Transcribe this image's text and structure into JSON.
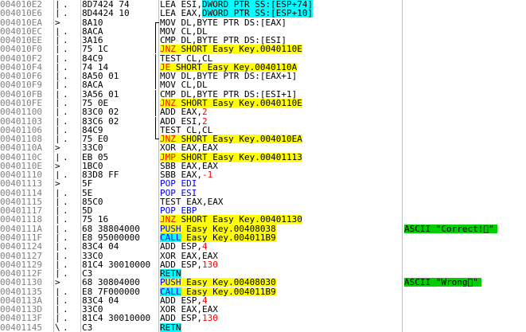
{
  "rows": [
    {
      "addr": "004010E2",
      "jm": "|",
      "dot": ".",
      "hex": "8D7424 74",
      "parts": [
        {
          "t": "LEA ESI,"
        },
        {
          "t": "DWORD PTR SS:[ESP+74]",
          "c": "hl-cyan"
        }
      ]
    },
    {
      "addr": "004010E6",
      "jm": "|",
      "dot": ".",
      "hex": "8D4424 10",
      "parts": [
        {
          "t": "LEA EAX,"
        },
        {
          "t": "DWORD PTR SS:[ESP+10]",
          "c": "hl-cyan"
        }
      ]
    },
    {
      "addr": "004010EA",
      "jm": ">",
      "dot": "",
      "hex": "8A10",
      "flow": "start",
      "parts": [
        {
          "t": "MOV DL,BYTE PTR DS:[EAX]"
        }
      ]
    },
    {
      "addr": "004010EC",
      "jm": "|",
      "dot": ".",
      "hex": "8ACA",
      "flow": "mid",
      "parts": [
        {
          "t": "MOV CL,DL"
        }
      ]
    },
    {
      "addr": "004010EE",
      "jm": "|",
      "dot": ".",
      "hex": "3A16",
      "flow": "mid",
      "parts": [
        {
          "t": "CMP DL,BYTE PTR DS:[ESI]"
        }
      ]
    },
    {
      "addr": "004010F0",
      "jm": "|",
      "dot": ".v",
      "hex": "75 1C",
      "flow": "mid",
      "parts": [
        {
          "t": "JNZ",
          "c": "hl kw-red"
        },
        {
          "t": " SHORT Easy_Key.0040110E",
          "c": "hl"
        }
      ]
    },
    {
      "addr": "004010F2",
      "jm": "|",
      "dot": ".",
      "hex": "84C9",
      "flow": "mid",
      "parts": [
        {
          "t": "TEST CL,CL"
        }
      ]
    },
    {
      "addr": "004010F4",
      "jm": "|",
      "dot": ".v",
      "hex": "74 14",
      "flow": "mid",
      "parts": [
        {
          "t": "JE",
          "c": "hl kw-red"
        },
        {
          "t": " SHORT Easy_Key.0040110A",
          "c": "hl"
        }
      ]
    },
    {
      "addr": "004010F6",
      "jm": "|",
      "dot": ".",
      "hex": "8A50 01",
      "flow": "mid",
      "parts": [
        {
          "t": "MOV DL,BYTE PTR DS:[EAX+1]"
        }
      ]
    },
    {
      "addr": "004010F9",
      "jm": "|",
      "dot": ".",
      "hex": "8ACA",
      "flow": "mid",
      "parts": [
        {
          "t": "MOV CL,DL"
        }
      ]
    },
    {
      "addr": "004010FB",
      "jm": "|",
      "dot": ".",
      "hex": "3A56 01",
      "flow": "mid",
      "parts": [
        {
          "t": "CMP DL,BYTE PTR DS:[ESI+1]"
        }
      ]
    },
    {
      "addr": "004010FE",
      "jm": "|",
      "dot": ".v",
      "hex": "75 0E",
      "flow": "mid",
      "parts": [
        {
          "t": "JNZ",
          "c": "hl kw-red"
        },
        {
          "t": " SHORT Easy_Key.0040110E",
          "c": "hl"
        }
      ]
    },
    {
      "addr": "00401100",
      "jm": "|",
      "dot": ".",
      "hex": "83C0 02",
      "flow": "mid",
      "parts": [
        {
          "t": "ADD EAX,"
        },
        {
          "t": "2",
          "c": "kw-red"
        }
      ]
    },
    {
      "addr": "00401103",
      "jm": "|",
      "dot": ".",
      "hex": "83C6 02",
      "flow": "mid",
      "parts": [
        {
          "t": "ADD ESI,"
        },
        {
          "t": "2",
          "c": "kw-red"
        }
      ]
    },
    {
      "addr": "00401106",
      "jm": "|",
      "dot": ".",
      "hex": "84C9",
      "flow": "mid",
      "parts": [
        {
          "t": "TEST CL,CL"
        }
      ]
    },
    {
      "addr": "00401108",
      "jm": "|",
      "dot": ".^",
      "hex": "75 E0",
      "flow": "end",
      "parts": [
        {
          "t": "JNZ",
          "c": "hl kw-red"
        },
        {
          "t": " SHORT Easy_Key.004010EA",
          "c": "hl"
        }
      ]
    },
    {
      "addr": "0040110A",
      "jm": ">",
      "dot": "",
      "hex": "33C0",
      "parts": [
        {
          "t": "XOR EAX,EAX"
        }
      ]
    },
    {
      "addr": "0040110C",
      "jm": "|",
      "dot": ".v",
      "hex": "EB 05",
      "parts": [
        {
          "t": "JMP",
          "c": "hl kw-red"
        },
        {
          "t": " SHORT Easy_Key.00401113",
          "c": "hl"
        }
      ]
    },
    {
      "addr": "0040110E",
      "jm": ">",
      "dot": "",
      "hex": "1BC0",
      "parts": [
        {
          "t": "SBB EAX,EAX"
        }
      ]
    },
    {
      "addr": "00401110",
      "jm": "|",
      "dot": ".",
      "hex": "83D8 FF",
      "parts": [
        {
          "t": "SBB EAX,"
        },
        {
          "t": "-1",
          "c": "kw-red"
        }
      ]
    },
    {
      "addr": "00401113",
      "jm": ">",
      "dot": "",
      "hex": "5F",
      "parts": [
        {
          "t": "POP EDI",
          "c": "kw-blue"
        }
      ]
    },
    {
      "addr": "00401114",
      "jm": "|",
      "dot": ".",
      "hex": "5E",
      "parts": [
        {
          "t": "POP ESI",
          "c": "kw-blue"
        }
      ]
    },
    {
      "addr": "00401115",
      "jm": "|",
      "dot": ".",
      "hex": "85C0",
      "parts": [
        {
          "t": "TEST EAX,EAX"
        }
      ]
    },
    {
      "addr": "00401117",
      "jm": "|",
      "dot": ".",
      "hex": "5D",
      "parts": [
        {
          "t": "POP EBP",
          "c": "kw-blue"
        }
      ]
    },
    {
      "addr": "00401118",
      "jm": "|",
      "dot": ".v",
      "hex": "75 16",
      "parts": [
        {
          "t": "JNZ",
          "c": "hl kw-red"
        },
        {
          "t": " SHORT Easy_Key.00401130",
          "c": "hl"
        }
      ]
    },
    {
      "addr": "0040111A",
      "jm": "|",
      "dot": ".",
      "hex": "68 38804000",
      "parts": [
        {
          "t": "PUSH",
          "c": "hl kw-blue"
        },
        {
          "t": " Easy_Key.00408038",
          "c": "hl"
        }
      ],
      "comment": "ASCII \"Correct!\u0000\""
    },
    {
      "addr": "0040111F",
      "jm": "|",
      "dot": ".",
      "hex": "E8 95000000",
      "parts": [
        {
          "t": "CALL",
          "c": "hl-cyan kw-blue"
        },
        {
          "t": " Easy_Key.004011B9",
          "c": "hl"
        }
      ]
    },
    {
      "addr": "00401124",
      "jm": "|",
      "dot": ".",
      "hex": "83C4 04",
      "parts": [
        {
          "t": "ADD ESP,"
        },
        {
          "t": "4",
          "c": "kw-red"
        }
      ]
    },
    {
      "addr": "00401127",
      "jm": "|",
      "dot": ".",
      "hex": "33C0",
      "parts": [
        {
          "t": "XOR EAX,EAX"
        }
      ]
    },
    {
      "addr": "00401129",
      "jm": "|",
      "dot": ".",
      "hex": "81C4 30010000",
      "parts": [
        {
          "t": "ADD ESP,"
        },
        {
          "t": "130",
          "c": "kw-red"
        }
      ]
    },
    {
      "addr": "0040112F",
      "jm": "|",
      "dot": ".",
      "hex": "C3",
      "parts": [
        {
          "t": "RETN",
          "c": "hl-cyan"
        }
      ]
    },
    {
      "addr": "00401130",
      "jm": ">",
      "dot": "",
      "hex": "68 30804000",
      "parts": [
        {
          "t": "PUSH",
          "c": "hl kw-blue"
        },
        {
          "t": " Easy_Key.00408030",
          "c": "hl"
        }
      ],
      "comment": "ASCII \"Wrong\u0000\""
    },
    {
      "addr": "00401135",
      "jm": "|",
      "dot": ".",
      "hex": "E8 7F000000",
      "parts": [
        {
          "t": "CALL",
          "c": "hl-cyan kw-blue"
        },
        {
          "t": " Easy_Key.004011B9",
          "c": "hl"
        }
      ]
    },
    {
      "addr": "0040113A",
      "jm": "|",
      "dot": ".",
      "hex": "83C4 04",
      "parts": [
        {
          "t": "ADD ESP,"
        },
        {
          "t": "4",
          "c": "kw-red"
        }
      ]
    },
    {
      "addr": "0040113D",
      "jm": "|",
      "dot": ".",
      "hex": "33C0",
      "parts": [
        {
          "t": "XOR EAX,EAX"
        }
      ]
    },
    {
      "addr": "0040113F",
      "jm": "|",
      "dot": ".",
      "hex": "81C4 30010000",
      "parts": [
        {
          "t": "ADD ESP,"
        },
        {
          "t": "130",
          "c": "kw-red"
        }
      ]
    },
    {
      "addr": "00401145",
      "jm": "\\",
      "dot": ".",
      "hex": "C3",
      "parts": [
        {
          "t": "RETN",
          "c": "hl-cyan"
        }
      ]
    }
  ]
}
